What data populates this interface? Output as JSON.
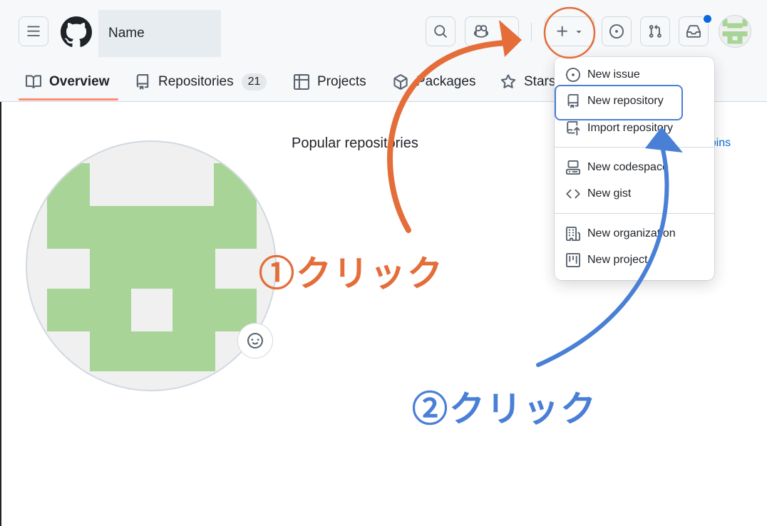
{
  "header": {
    "username": "Name"
  },
  "tabs": [
    {
      "label": "Overview"
    },
    {
      "label": "Repositories",
      "count": "21"
    },
    {
      "label": "Projects"
    },
    {
      "label": "Packages"
    },
    {
      "label": "Stars"
    }
  ],
  "main": {
    "popular_title": "Popular repositories",
    "customize_pins": "r pins"
  },
  "create_menu": {
    "items": [
      {
        "label": "New issue",
        "icon": "issue-opened-icon"
      },
      {
        "label": "New repository",
        "icon": "repo-icon"
      },
      {
        "label": "Import repository",
        "icon": "repo-push-icon"
      },
      {
        "label": "New codespace",
        "icon": "codespaces-icon"
      },
      {
        "label": "New gist",
        "icon": "code-icon"
      },
      {
        "label": "New organization",
        "icon": "organization-icon"
      },
      {
        "label": "New project",
        "icon": "project-icon"
      }
    ]
  },
  "annotations": {
    "step1": "①クリック",
    "step2": "②クリック"
  },
  "colors": {
    "step1": "#e46d3a",
    "step2": "#4a7fd6",
    "identicon": "#a8d597",
    "underline": "#fd8c73"
  }
}
